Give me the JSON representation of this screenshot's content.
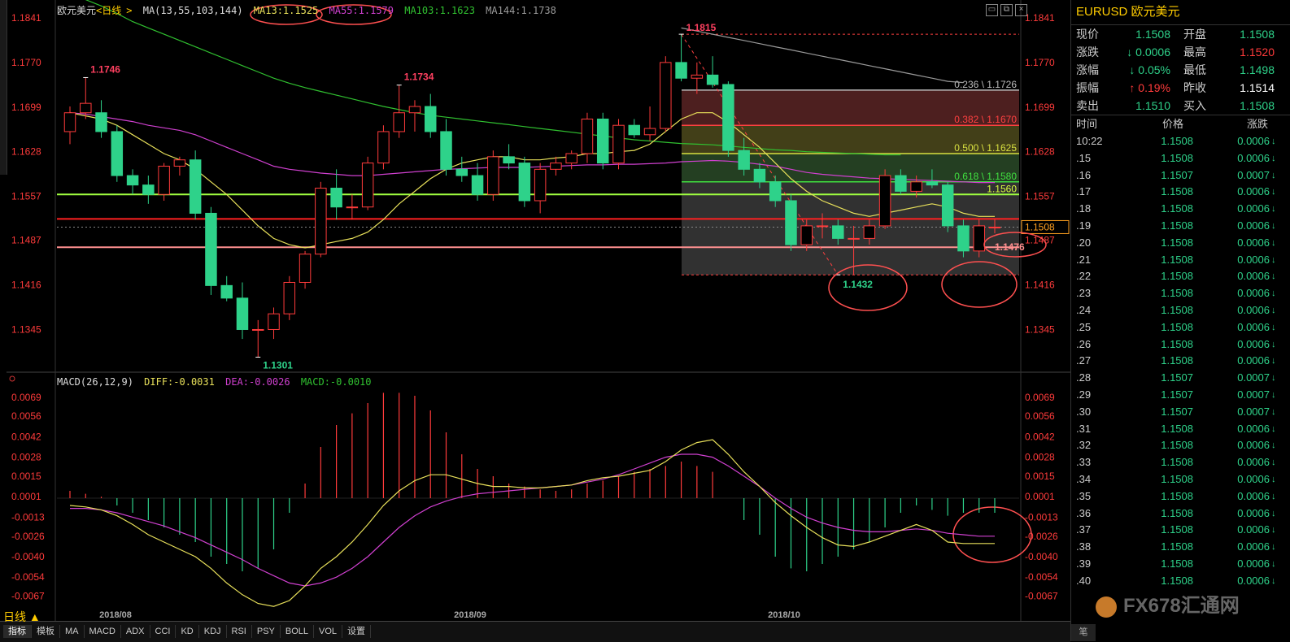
{
  "instrument": {
    "name": "欧元美元",
    "period": "日线",
    "symbol": "EURUSD"
  },
  "ma_legend": {
    "prefix": "MA(13,55,103,144)",
    "ma13": "MA13:1.1525",
    "ma55": "MA55:1.1579",
    "ma103": "MA103:1.1623",
    "ma144": "MA144:1.1738"
  },
  "macd_legend": {
    "prefix": "MACD(26,12,9)",
    "diff": "DIFF:-0.0031",
    "dea": "DEA:-0.0026",
    "macd": "MACD:-0.0010"
  },
  "price_axis": [
    "1.1841",
    "1.1770",
    "1.1699",
    "1.1628",
    "1.1557",
    "1.1487",
    "1.1416",
    "1.1345"
  ],
  "macd_axis": [
    "0.0069",
    "0.0056",
    "0.0042",
    "0.0028",
    "0.0015",
    "0.0001",
    "-0.0013",
    "-0.0026",
    "-0.0040",
    "-0.0054",
    "-0.0067"
  ],
  "date_labels": [
    "2018/08",
    "2018/09",
    "2018/10"
  ],
  "annotations": {
    "high1": "1.1746",
    "high2": "1.1734",
    "low1": "1.1301",
    "high3": "1.1815",
    "low2": "1.1432",
    "current": "1.1508",
    "support": "1.1476",
    "level_1560": "1.1560"
  },
  "fib": {
    "f236": "0.236 \\ 1.1726",
    "f382": "0.382 \\ 1.1670",
    "f500": "0.500 \\ 1.1625",
    "f618": "0.618 \\ 1.1580"
  },
  "bottom": {
    "period": "日线 ▲",
    "tabs": [
      "指标",
      "模板",
      "MA",
      "MACD",
      "ADX",
      "CCI",
      "KD",
      "KDJ",
      "RSI",
      "PSY",
      "BOLL",
      "VOL",
      "设置"
    ]
  },
  "quote": {
    "rows": [
      {
        "l1": "现价",
        "v1": "1.1508",
        "l2": "开盘",
        "v2": "1.1508"
      },
      {
        "l1": "涨跌",
        "v1": "↓ 0.0006",
        "l2": "最高",
        "v2": "1.1520"
      },
      {
        "l1": "涨幅",
        "v1": "↓ 0.05%",
        "l2": "最低",
        "v2": "1.1498"
      },
      {
        "l1": "振幅",
        "v1": "↑ 0.19%",
        "l2": "昨收",
        "v2": "1.1514"
      },
      {
        "l1": "卖出",
        "v1": "1.1510",
        "l2": "买入",
        "v2": "1.1508"
      }
    ],
    "colors": {
      "v1": [
        "green",
        "green",
        "green",
        "red",
        "green"
      ],
      "v2": [
        "green",
        "red",
        "green",
        "white",
        "green"
      ]
    }
  },
  "ticks_header": {
    "time": "时间",
    "price": "价格",
    "change": "涨跌"
  },
  "ticks": [
    {
      "t": "10:22",
      "p": "1.1508",
      "c": "0.0006"
    },
    {
      "t": ".15",
      "p": "1.1508",
      "c": "0.0006"
    },
    {
      "t": ".16",
      "p": "1.1507",
      "c": "0.0007"
    },
    {
      "t": ".17",
      "p": "1.1508",
      "c": "0.0006"
    },
    {
      "t": ".18",
      "p": "1.1508",
      "c": "0.0006"
    },
    {
      "t": ".19",
      "p": "1.1508",
      "c": "0.0006"
    },
    {
      "t": ".20",
      "p": "1.1508",
      "c": "0.0006"
    },
    {
      "t": ".21",
      "p": "1.1508",
      "c": "0.0006"
    },
    {
      "t": ".22",
      "p": "1.1508",
      "c": "0.0006"
    },
    {
      "t": ".23",
      "p": "1.1508",
      "c": "0.0006"
    },
    {
      "t": ".24",
      "p": "1.1508",
      "c": "0.0006"
    },
    {
      "t": ".25",
      "p": "1.1508",
      "c": "0.0006"
    },
    {
      "t": ".26",
      "p": "1.1508",
      "c": "0.0006"
    },
    {
      "t": ".27",
      "p": "1.1508",
      "c": "0.0006"
    },
    {
      "t": ".28",
      "p": "1.1507",
      "c": "0.0007"
    },
    {
      "t": ".29",
      "p": "1.1507",
      "c": "0.0007"
    },
    {
      "t": ".30",
      "p": "1.1507",
      "c": "0.0007"
    },
    {
      "t": ".31",
      "p": "1.1508",
      "c": "0.0006"
    },
    {
      "t": ".32",
      "p": "1.1508",
      "c": "0.0006"
    },
    {
      "t": ".33",
      "p": "1.1508",
      "c": "0.0006"
    },
    {
      "t": ".34",
      "p": "1.1508",
      "c": "0.0006"
    },
    {
      "t": ".35",
      "p": "1.1508",
      "c": "0.0006"
    },
    {
      "t": ".36",
      "p": "1.1508",
      "c": "0.0006"
    },
    {
      "t": ".37",
      "p": "1.1508",
      "c": "0.0006"
    },
    {
      "t": ".38",
      "p": "1.1508",
      "c": "0.0006"
    },
    {
      "t": ".39",
      "p": "1.1508",
      "c": "0.0006"
    },
    {
      "t": ".40",
      "p": "1.1508",
      "c": "0.0006"
    }
  ],
  "watermark": "FX678汇通网",
  "rp_bottom": "笔",
  "colors": {
    "up": "#ff3b3b",
    "down": "#2ed28a",
    "ma13": "#e8e05a",
    "ma55": "#d040d0",
    "ma103": "#30c030",
    "ma144": "#9a9a9a",
    "axis_red": "#ff3b3b"
  },
  "chart_data": {
    "type": "candlestick",
    "ylim": [
      1.129,
      1.1841
    ],
    "candles": [
      {
        "o": 1.166,
        "h": 1.17,
        "l": 1.164,
        "c": 1.169
      },
      {
        "o": 1.169,
        "h": 1.1746,
        "l": 1.168,
        "c": 1.1705
      },
      {
        "o": 1.169,
        "h": 1.171,
        "l": 1.165,
        "c": 1.166
      },
      {
        "o": 1.166,
        "h": 1.167,
        "l": 1.158,
        "c": 1.159
      },
      {
        "o": 1.159,
        "h": 1.16,
        "l": 1.156,
        "c": 1.1575
      },
      {
        "o": 1.1575,
        "h": 1.159,
        "l": 1.1545,
        "c": 1.156
      },
      {
        "o": 1.156,
        "h": 1.161,
        "l": 1.155,
        "c": 1.1605
      },
      {
        "o": 1.1605,
        "h": 1.162,
        "l": 1.159,
        "c": 1.1615
      },
      {
        "o": 1.1615,
        "h": 1.163,
        "l": 1.152,
        "c": 1.153
      },
      {
        "o": 1.153,
        "h": 1.154,
        "l": 1.14,
        "c": 1.1415
      },
      {
        "o": 1.1415,
        "h": 1.143,
        "l": 1.139,
        "c": 1.1395
      },
      {
        "o": 1.1395,
        "h": 1.142,
        "l": 1.133,
        "c": 1.1345
      },
      {
        "o": 1.1345,
        "h": 1.136,
        "l": 1.1301,
        "c": 1.1345
      },
      {
        "o": 1.1345,
        "h": 1.138,
        "l": 1.133,
        "c": 1.137
      },
      {
        "o": 1.137,
        "h": 1.143,
        "l": 1.136,
        "c": 1.142
      },
      {
        "o": 1.142,
        "h": 1.147,
        "l": 1.141,
        "c": 1.1465
      },
      {
        "o": 1.1465,
        "h": 1.158,
        "l": 1.146,
        "c": 1.157
      },
      {
        "o": 1.157,
        "h": 1.16,
        "l": 1.152,
        "c": 1.154
      },
      {
        "o": 1.154,
        "h": 1.156,
        "l": 1.152,
        "c": 1.154
      },
      {
        "o": 1.154,
        "h": 1.162,
        "l": 1.1535,
        "c": 1.161
      },
      {
        "o": 1.161,
        "h": 1.167,
        "l": 1.16,
        "c": 1.166
      },
      {
        "o": 1.166,
        "h": 1.1734,
        "l": 1.165,
        "c": 1.169
      },
      {
        "o": 1.169,
        "h": 1.171,
        "l": 1.166,
        "c": 1.17
      },
      {
        "o": 1.17,
        "h": 1.172,
        "l": 1.165,
        "c": 1.166
      },
      {
        "o": 1.166,
        "h": 1.168,
        "l": 1.159,
        "c": 1.16
      },
      {
        "o": 1.16,
        "h": 1.162,
        "l": 1.158,
        "c": 1.159
      },
      {
        "o": 1.159,
        "h": 1.161,
        "l": 1.155,
        "c": 1.156
      },
      {
        "o": 1.156,
        "h": 1.163,
        "l": 1.155,
        "c": 1.162
      },
      {
        "o": 1.162,
        "h": 1.164,
        "l": 1.16,
        "c": 1.161
      },
      {
        "o": 1.161,
        "h": 1.162,
        "l": 1.154,
        "c": 1.155
      },
      {
        "o": 1.155,
        "h": 1.161,
        "l": 1.153,
        "c": 1.16
      },
      {
        "o": 1.16,
        "h": 1.162,
        "l": 1.159,
        "c": 1.161
      },
      {
        "o": 1.161,
        "h": 1.163,
        "l": 1.16,
        "c": 1.1625
      },
      {
        "o": 1.1625,
        "h": 1.169,
        "l": 1.161,
        "c": 1.168
      },
      {
        "o": 1.168,
        "h": 1.169,
        "l": 1.16,
        "c": 1.161
      },
      {
        "o": 1.161,
        "h": 1.168,
        "l": 1.16,
        "c": 1.167
      },
      {
        "o": 1.167,
        "h": 1.168,
        "l": 1.165,
        "c": 1.1655
      },
      {
        "o": 1.1655,
        "h": 1.17,
        "l": 1.1645,
        "c": 1.1665
      },
      {
        "o": 1.1665,
        "h": 1.178,
        "l": 1.166,
        "c": 1.177
      },
      {
        "o": 1.177,
        "h": 1.1815,
        "l": 1.174,
        "c": 1.1745
      },
      {
        "o": 1.1745,
        "h": 1.177,
        "l": 1.172,
        "c": 1.175
      },
      {
        "o": 1.175,
        "h": 1.178,
        "l": 1.173,
        "c": 1.1735
      },
      {
        "o": 1.1735,
        "h": 1.174,
        "l": 1.162,
        "c": 1.163
      },
      {
        "o": 1.163,
        "h": 1.165,
        "l": 1.159,
        "c": 1.16
      },
      {
        "o": 1.16,
        "h": 1.161,
        "l": 1.157,
        "c": 1.158
      },
      {
        "o": 1.158,
        "h": 1.159,
        "l": 1.154,
        "c": 1.155
      },
      {
        "o": 1.155,
        "h": 1.156,
        "l": 1.147,
        "c": 1.148
      },
      {
        "o": 1.148,
        "h": 1.152,
        "l": 1.147,
        "c": 1.151
      },
      {
        "o": 1.151,
        "h": 1.153,
        "l": 1.149,
        "c": 1.151
      },
      {
        "o": 1.151,
        "h": 1.152,
        "l": 1.148,
        "c": 1.149
      },
      {
        "o": 1.149,
        "h": 1.151,
        "l": 1.1432,
        "c": 1.149
      },
      {
        "o": 1.149,
        "h": 1.152,
        "l": 1.148,
        "c": 1.151
      },
      {
        "o": 1.151,
        "h": 1.16,
        "l": 1.1505,
        "c": 1.159
      },
      {
        "o": 1.159,
        "h": 1.16,
        "l": 1.156,
        "c": 1.1565
      },
      {
        "o": 1.1565,
        "h": 1.159,
        "l": 1.1555,
        "c": 1.158
      },
      {
        "o": 1.158,
        "h": 1.16,
        "l": 1.157,
        "c": 1.1575
      },
      {
        "o": 1.1575,
        "h": 1.158,
        "l": 1.15,
        "c": 1.151
      },
      {
        "o": 1.151,
        "h": 1.152,
        "l": 1.146,
        "c": 1.147
      },
      {
        "o": 1.147,
        "h": 1.152,
        "l": 1.146,
        "c": 1.151
      },
      {
        "o": 1.1508,
        "h": 1.152,
        "l": 1.1498,
        "c": 1.1508
      }
    ],
    "ma13": [
      1.169,
      1.1685,
      1.168,
      1.167,
      1.1655,
      1.164,
      1.1625,
      1.1615,
      1.16,
      1.158,
      1.156,
      1.1535,
      1.151,
      1.149,
      1.148,
      1.1475,
      1.148,
      1.1485,
      1.149,
      1.15,
      1.152,
      1.1545,
      1.1565,
      1.1585,
      1.16,
      1.161,
      1.1615,
      1.162,
      1.162,
      1.1615,
      1.1615,
      1.1618,
      1.162,
      1.1625,
      1.1625,
      1.1628,
      1.163,
      1.164,
      1.166,
      1.168,
      1.169,
      1.169,
      1.1675,
      1.1655,
      1.1635,
      1.161,
      1.1585,
      1.1565,
      1.155,
      1.154,
      1.153,
      1.1525,
      1.153,
      1.1535,
      1.154,
      1.1545,
      1.154,
      1.153,
      1.1525,
      1.1525
    ],
    "ma55": [
      1.169,
      1.1688,
      1.1684,
      1.168,
      1.1676,
      1.167,
      1.1666,
      1.1662,
      1.1655,
      1.1645,
      1.1635,
      1.1625,
      1.1615,
      1.1605,
      1.16,
      1.1597,
      1.1594,
      1.1592,
      1.159,
      1.159,
      1.1592,
      1.1594,
      1.1596,
      1.1598,
      1.16,
      1.1601,
      1.1602,
      1.1603,
      1.1603,
      1.1603,
      1.1604,
      1.1605,
      1.1606,
      1.1607,
      1.1607,
      1.1608,
      1.1608,
      1.1609,
      1.161,
      1.1612,
      1.1613,
      1.1614,
      1.1613,
      1.1611,
      1.1608,
      1.1605,
      1.16,
      1.1595,
      1.1592,
      1.159,
      1.1588,
      1.1586,
      1.1585,
      1.1584,
      1.1583,
      1.1582,
      1.1581,
      1.158,
      1.1579,
      1.1579
    ],
    "ma103_partial": [
      1.188,
      1.187,
      1.186,
      1.1848,
      1.1835,
      1.1825,
      1.1815,
      1.1805,
      1.1795,
      1.1785,
      1.1775,
      1.1765,
      1.1755,
      1.1745,
      1.1737,
      1.173,
      1.1724,
      1.1718,
      1.1712,
      1.1706,
      1.17,
      1.1695,
      1.169,
      1.1686,
      1.1683,
      1.168,
      1.1677,
      1.1674,
      1.1671,
      1.1668,
      1.1665,
      1.1662,
      1.1659,
      1.1656,
      1.1653,
      1.165,
      1.1647,
      1.1645,
      1.1643,
      1.1641,
      1.164,
      1.1639,
      1.1637,
      1.1635,
      1.1633,
      1.1631,
      1.163,
      1.1628,
      1.1627,
      1.1626,
      1.1625,
      1.1624,
      1.1623,
      1.1623
    ],
    "ma144_partial_start": 39,
    "ma144_partial": [
      1.1825,
      1.182,
      1.1815,
      1.181,
      1.1805,
      1.18,
      1.1795,
      1.179,
      1.1785,
      1.178,
      1.1775,
      1.177,
      1.1765,
      1.176,
      1.1755,
      1.175,
      1.1745,
      1.174,
      1.1738
    ],
    "macd_ylim": [
      -0.0075,
      0.0075
    ],
    "macd_hist": [
      0.0005,
      0.0003,
      0.0001,
      -0.0005,
      -0.001,
      -0.0015,
      -0.002,
      -0.0025,
      -0.003,
      -0.004,
      -0.0045,
      -0.005,
      -0.0048,
      -0.0035,
      -0.001,
      0.001,
      0.0035,
      0.005,
      0.0058,
      0.0065,
      0.0072,
      0.0072,
      0.007,
      0.006,
      0.0045,
      0.003,
      0.002,
      0.0015,
      0.001,
      0.0008,
      0.0006,
      0.0005,
      0.0006,
      0.001,
      0.0012,
      0.0015,
      0.0018,
      0.002,
      0.0022,
      0.0025,
      0.0022,
      0.0018,
      0.0,
      -0.0015,
      -0.0025,
      -0.004,
      -0.0048,
      -0.005,
      -0.0045,
      -0.004,
      -0.0035,
      -0.003,
      -0.002,
      -0.001,
      -0.0005,
      -0.0008,
      -0.0012,
      -0.001,
      -0.001,
      -0.001
    ],
    "diff": [
      -0.0005,
      -0.0006,
      -0.0008,
      -0.0012,
      -0.0018,
      -0.0025,
      -0.003,
      -0.0035,
      -0.004,
      -0.0048,
      -0.0058,
      -0.0066,
      -0.0072,
      -0.0074,
      -0.007,
      -0.006,
      -0.0048,
      -0.004,
      -0.003,
      -0.0018,
      -0.0005,
      0.0005,
      0.0012,
      0.0016,
      0.0016,
      0.0013,
      0.001,
      0.0008,
      0.0008,
      0.0007,
      0.0007,
      0.0008,
      0.0009,
      0.0012,
      0.0014,
      0.0015,
      0.0017,
      0.0019,
      0.0025,
      0.0033,
      0.0038,
      0.004,
      0.003,
      0.0018,
      0.0008,
      -0.0003,
      -0.0012,
      -0.002,
      -0.0027,
      -0.0032,
      -0.0033,
      -0.003,
      -0.0026,
      -0.0022,
      -0.0018,
      -0.0022,
      -0.003,
      -0.0031,
      -0.0031,
      -0.0031
    ],
    "dea": [
      -0.0007,
      -0.0007,
      -0.0008,
      -0.001,
      -0.0013,
      -0.0016,
      -0.0019,
      -0.0023,
      -0.0027,
      -0.0032,
      -0.0037,
      -0.0042,
      -0.0048,
      -0.0053,
      -0.0058,
      -0.006,
      -0.0058,
      -0.0054,
      -0.0048,
      -0.004,
      -0.003,
      -0.002,
      -0.0012,
      -0.0006,
      -0.0002,
      0.0001,
      0.0003,
      0.0004,
      0.0005,
      0.0006,
      0.0007,
      0.0008,
      0.0009,
      0.0011,
      0.0013,
      0.0016,
      0.002,
      0.0024,
      0.0028,
      0.003,
      0.003,
      0.0028,
      0.0022,
      0.0015,
      0.0008,
      0.0,
      -0.0007,
      -0.0013,
      -0.0017,
      -0.002,
      -0.0022,
      -0.0023,
      -0.0023,
      -0.0022,
      -0.0021,
      -0.0022,
      -0.0024,
      -0.0025,
      -0.0026,
      -0.0026
    ]
  }
}
